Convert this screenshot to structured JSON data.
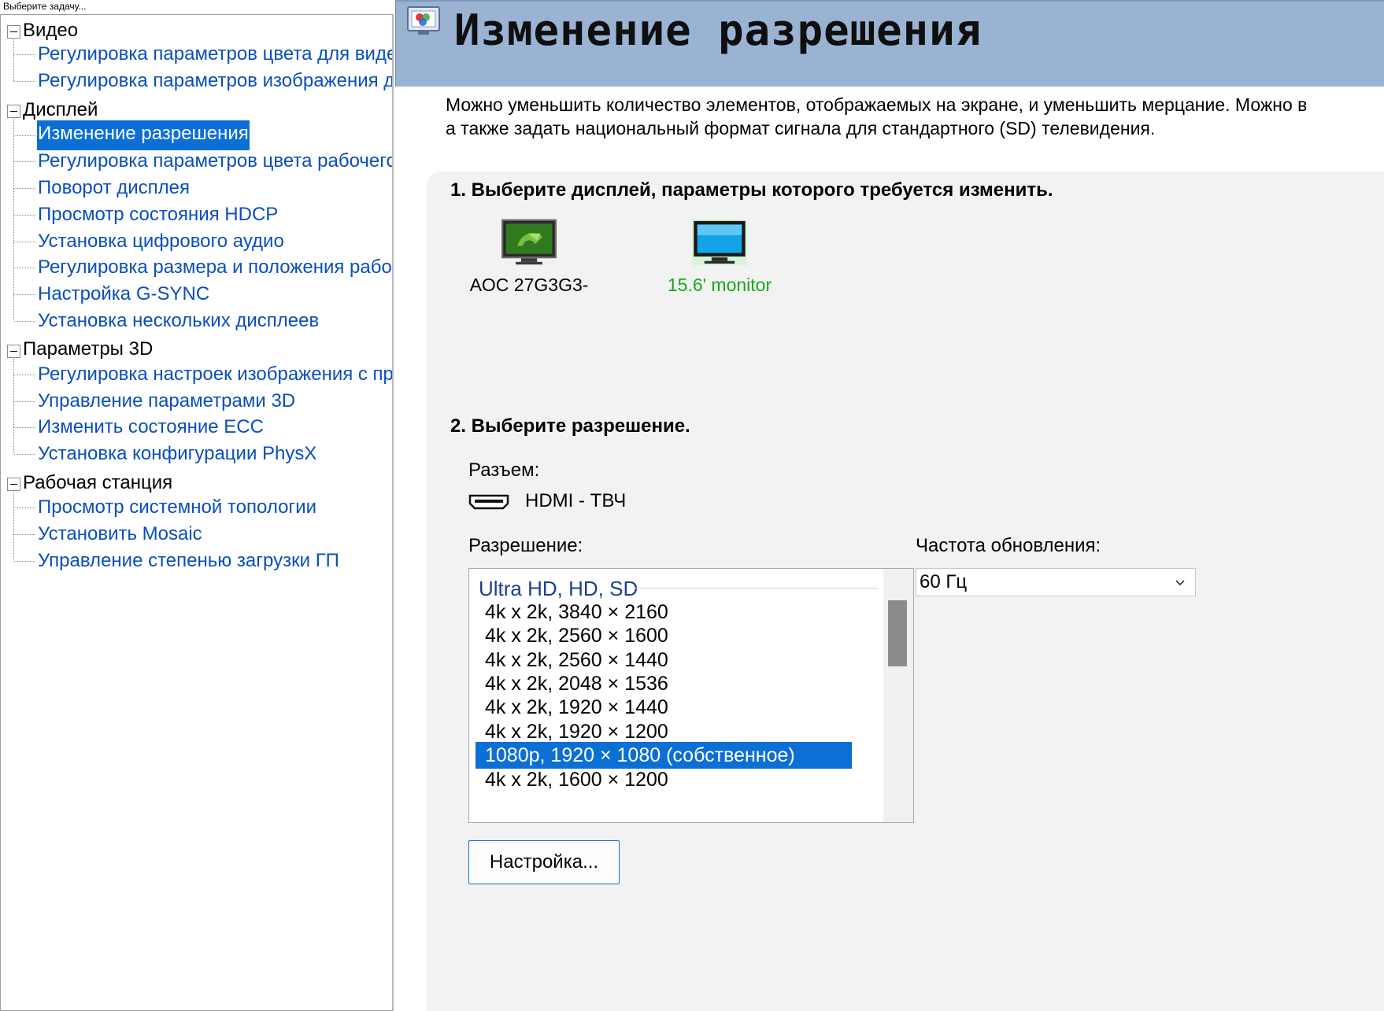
{
  "left_panel": {
    "caption": "Выберите задачу...",
    "tree": [
      {
        "category": "Видео",
        "items": [
          "Регулировка параметров цвета для видео",
          "Регулировка параметров изображения для видео"
        ]
      },
      {
        "category": "Дисплей",
        "items": [
          "Изменение разрешения",
          "Регулировка параметров цвета рабочего стола",
          "Поворот дисплея",
          "Просмотр состояния HDCP",
          "Установка цифрового аудио",
          "Регулировка размера и положения рабочего стола",
          "Настройка G-SYNC",
          "Установка нескольких дисплеев"
        ]
      },
      {
        "category": "Параметры 3D",
        "items": [
          "Регулировка настроек изображения с просмотром",
          "Управление параметрами 3D",
          "Изменить состояние ECC",
          "Установка конфигурации PhysX"
        ]
      },
      {
        "category": "Рабочая станция",
        "items": [
          "Просмотр системной топологии",
          "Установить Mosaic",
          "Управление степенью загрузки ГП"
        ]
      }
    ],
    "selected_item": "Изменение разрешения"
  },
  "header": {
    "title": "Изменение разрешения",
    "icon": "display-settings-icon"
  },
  "intro": {
    "line1": "Можно уменьшить количество элементов, отображаемых на экране, и уменьшить мерцание. Можно в",
    "line2": "а также задать национальный формат сигнала для стандартного (SD) телевидения."
  },
  "step1": {
    "title": "1. Выберите дисплей, параметры которого требуется изменить.",
    "displays": [
      {
        "label": "AOC 27G3G3-",
        "icon": "nvidia-monitor-icon",
        "active": false
      },
      {
        "label": "15.6' monitor",
        "icon": "monitor-icon",
        "active": true
      }
    ]
  },
  "step2": {
    "title": "2. Выберите разрешение.",
    "connector_label": "Разъем:",
    "connector_value": "HDMI - ТВЧ",
    "connector_icon": "hdmi-icon",
    "resolution_label": "Разрешение:",
    "resolution_group": "Ultra HD, HD, SD",
    "resolutions": [
      "4k x 2k, 3840 × 2160",
      "4k x 2k, 2560 × 1600",
      "4k x 2k, 2560 × 1440",
      "4k x 2k, 2048 × 1536",
      "4k x 2k, 1920 × 1440",
      "4k x 2k, 1920 × 1200",
      "1080p, 1920 × 1080 (собственное)",
      "4k x 2k, 1600 × 1200"
    ],
    "selected_resolution": "1080p, 1920 × 1080 (собственное)",
    "refresh_label": "Частота обновления:",
    "refresh_value": "60 Гц",
    "settings_button": "Настройка..."
  },
  "colors": {
    "header_bg": "#9bb3d3",
    "selection": "#0c6fd6",
    "link": "#0a4ebd",
    "active_display_label": "#17a817",
    "group_label": "#1d3f8f"
  }
}
